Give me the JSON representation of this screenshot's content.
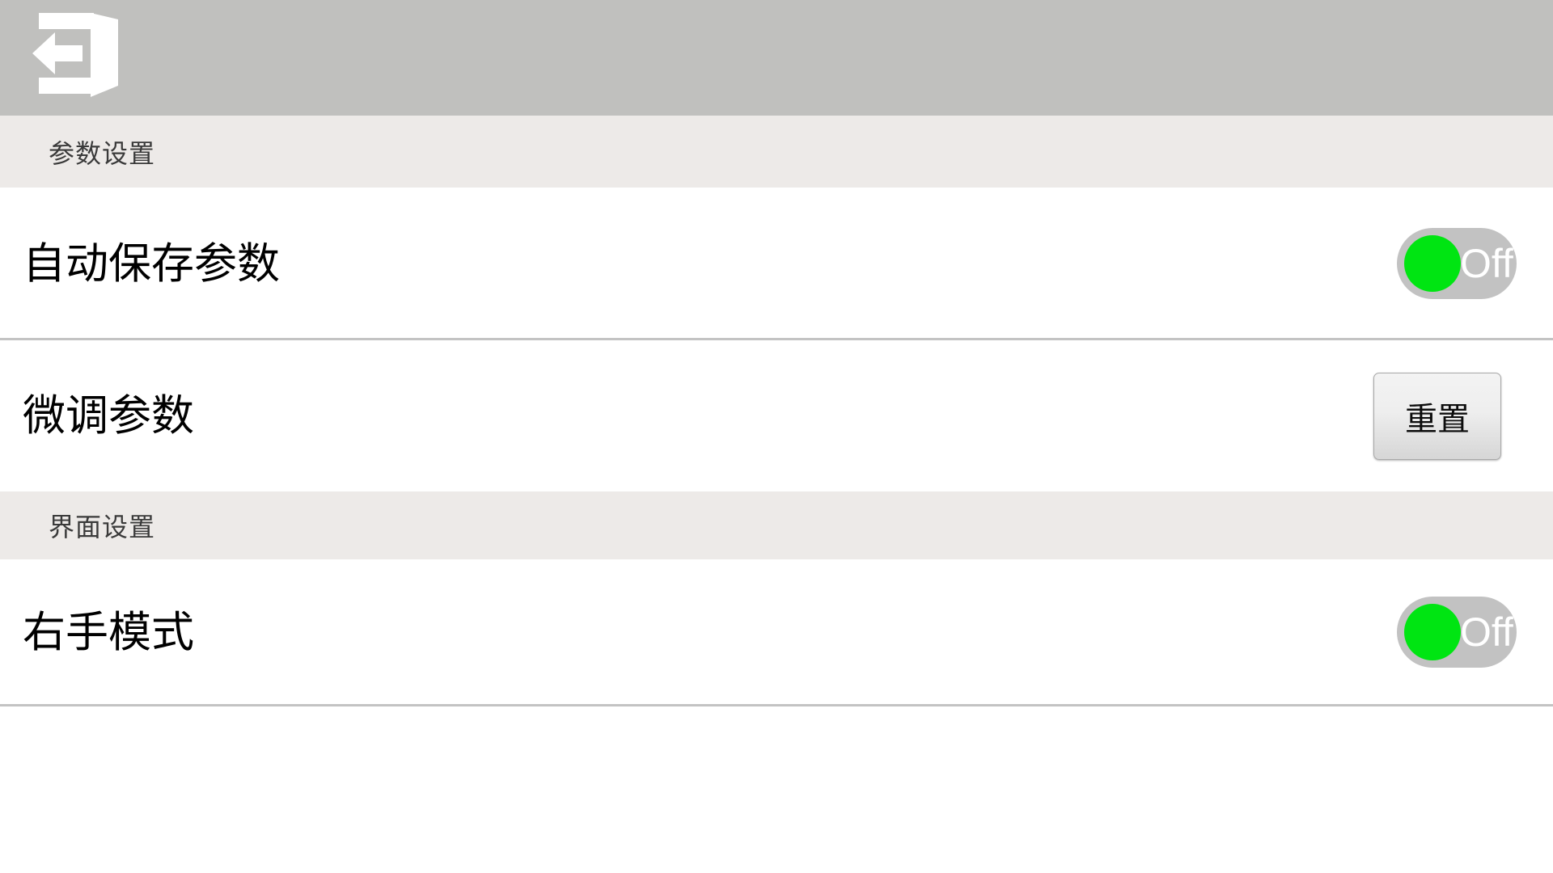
{
  "titlebar": {
    "title": "",
    "back_icon": "exit-door-back-icon",
    "background_color": "#c0c0be",
    "icon_color": "#ffffff"
  },
  "sections": [
    {
      "id": "params",
      "label": "参数设置",
      "background_color": "#edeae8"
    },
    {
      "id": "ui",
      "label": "界面设置",
      "background_color": "#edeae8"
    }
  ],
  "rows": {
    "autosave": {
      "label": "自动保存参数",
      "control": "toggle",
      "toggle": {
        "state_label": "Off",
        "checked": false,
        "knob_color": "#00e512",
        "track_color": "#c2c2c2",
        "text_color": "#ffffff"
      }
    },
    "finetune": {
      "label": "微调参数",
      "control": "button",
      "button": {
        "label": "重置"
      }
    },
    "righthand": {
      "label": "右手模式",
      "control": "toggle",
      "toggle": {
        "state_label": "Off",
        "checked": false,
        "knob_color": "#00e512",
        "track_color": "#c2c2c2",
        "text_color": "#ffffff"
      }
    }
  },
  "colors": {
    "page_background": "#ffffff",
    "divider": "#c3c3c3",
    "row_text": "#000000",
    "section_text": "#3a3a3a"
  }
}
